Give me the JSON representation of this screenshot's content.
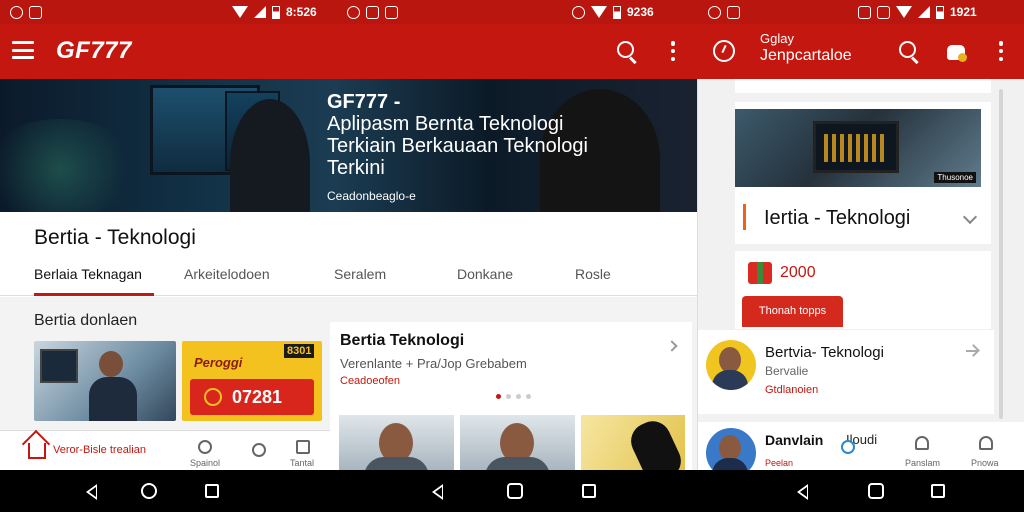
{
  "status_bar": {
    "time_left": "8:526",
    "time_mid": "9236",
    "time_right": "1921"
  },
  "app_bar": {
    "title": "GF777",
    "right_title_line1": "Gglay",
    "right_title_line2": "Jenpcartaloe"
  },
  "hero": {
    "title": "GF777 -",
    "body": "Aplipasm Bernta Teknologi Terkiain Berkauaan Teknologi Terkini",
    "tag": "Ceadonbeaglo-e"
  },
  "main": {
    "section_title": "Bertia - Teknologi",
    "tabs": [
      {
        "label": "Berlaia Teknagan"
      },
      {
        "label": "Arkeitelodoen"
      },
      {
        "label": "Seralem"
      },
      {
        "label": "Donkane"
      },
      {
        "label": "Rosle"
      }
    ],
    "sub_title": "Bertia donlaen",
    "promo": {
      "brand": "Peroggi",
      "badge": "8301",
      "code": "07281"
    },
    "card": {
      "title": "Bertia Teknologi",
      "subtitle": "Verenlante + Pra/Jop Grebabem",
      "tag": "Ceadoeofen"
    }
  },
  "bottom_nav": {
    "home_label": "Veror-Bisle trealian",
    "item2": "Spainol",
    "item4": "Tantal",
    "item5": "Panslam",
    "item6": "Pnowa"
  },
  "right_panel": {
    "section_title": "Iertia - Teknologi",
    "img_brand": "Thusonoe",
    "amount": "2000",
    "button": "Thonah topps",
    "row1": {
      "title": "Bertvia- Teknologi",
      "subtitle": "Bervalie",
      "tag": "Gtdlanoien"
    },
    "row2": {
      "title": "Danvlain",
      "extra": "Iloudi",
      "tag": "Peelan"
    }
  },
  "colors": {
    "accent": "#c4170f",
    "orange_bar": "#e8641b",
    "promo_yellow": "#f4c21f"
  }
}
